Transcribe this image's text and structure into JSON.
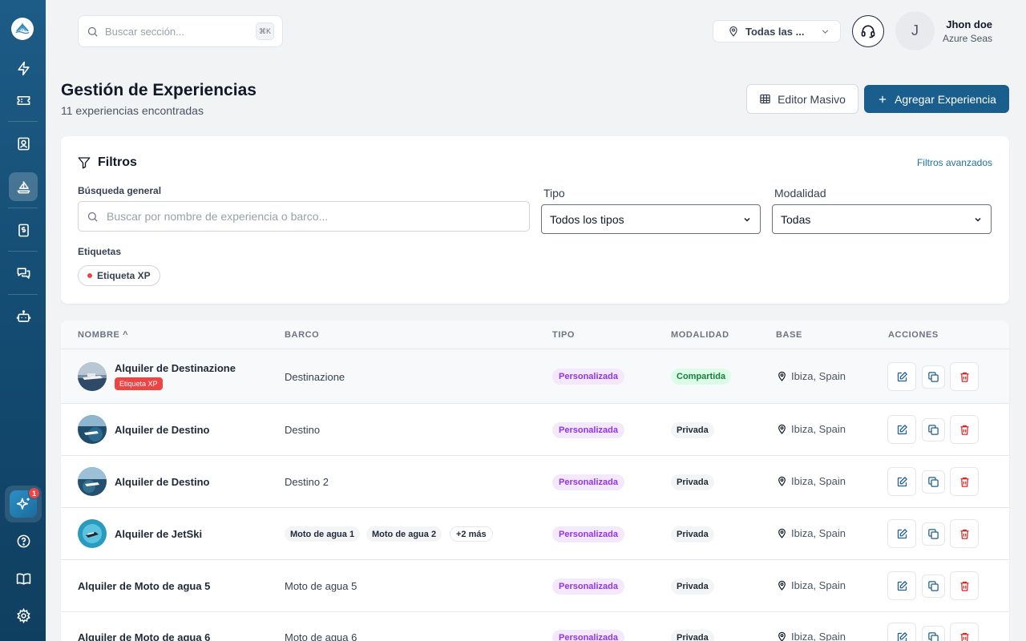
{
  "top": {
    "search_placeholder": "Buscar sección...",
    "kbd_hint": "⌘K",
    "location": "Todas las ...",
    "user_initial": "J",
    "user_name": "Jhon doe",
    "user_org": "Azure Seas"
  },
  "sidebar": {
    "notification_count": "1",
    "icons": [
      "bolt-icon",
      "ticket-icon",
      "contacts-icon",
      "sailboat-icon",
      "invoice-icon",
      "chat-icon",
      "bot-icon",
      "sparkle-icon",
      "help-icon",
      "book-icon",
      "gear-icon"
    ]
  },
  "header": {
    "title": "Gestión de Experiencias",
    "subtitle": "11 experiencias encontradas",
    "bulk_label": "Editor Masivo",
    "add_label": "Agregar Experiencia"
  },
  "filters": {
    "title": "Filtros",
    "advanced": "Filtros avanzados",
    "search_label": "Búsqueda general",
    "search_placeholder": "Buscar por nombre de experiencia o barco...",
    "type_label": "Tipo",
    "type_value": "Todos los tipos",
    "mode_label": "Modalidad",
    "mode_value": "Todas",
    "tags_label": "Etiquetas",
    "tag": "Etiqueta XP"
  },
  "table": {
    "headers": {
      "name": "NOMBRE",
      "sort_arrow": "^",
      "boat": "BARCO",
      "type": "TIPO",
      "mode": "MODALIDAD",
      "base": "BASE",
      "actions": "ACCIONES"
    },
    "rows": [
      {
        "name": "Alquiler de Destinazione",
        "tag": "Etiqueta XP",
        "boat": "Destinazione",
        "type": "Personalizada",
        "mode": "Compartida",
        "base": "Ibiza, Spain"
      },
      {
        "name": "Alquiler de Destino",
        "boat": "Destino",
        "type": "Personalizada",
        "mode": "Privada",
        "base": "Ibiza, Spain"
      },
      {
        "name": "Alquiler de Destino",
        "boat": "Destino 2",
        "type": "Personalizada",
        "mode": "Privada",
        "base": "Ibiza, Spain"
      },
      {
        "name": "Alquiler de JetSki",
        "boats": [
          "Moto de agua 1",
          "Moto de agua 2"
        ],
        "boats_more": "+2 más",
        "type": "Personalizada",
        "mode": "Privada",
        "base": "Ibiza, Spain"
      },
      {
        "name": "Alquiler de Moto de agua 5",
        "boat": "Moto de agua 5",
        "type": "Personalizada",
        "mode": "Privada",
        "base": "Ibiza, Spain"
      },
      {
        "name": "Alquiler de Moto de agua 6",
        "boat": "Moto de agua 6",
        "type": "Personalizada",
        "mode": "Privada",
        "base": "Ibiza, Spain"
      }
    ]
  },
  "colors": {
    "sidebar": "#1a5b85",
    "primary": "#1a5e8e",
    "type_badge": "#9333ea",
    "shared_badge": "#15803d",
    "delete": "#dc2626"
  }
}
